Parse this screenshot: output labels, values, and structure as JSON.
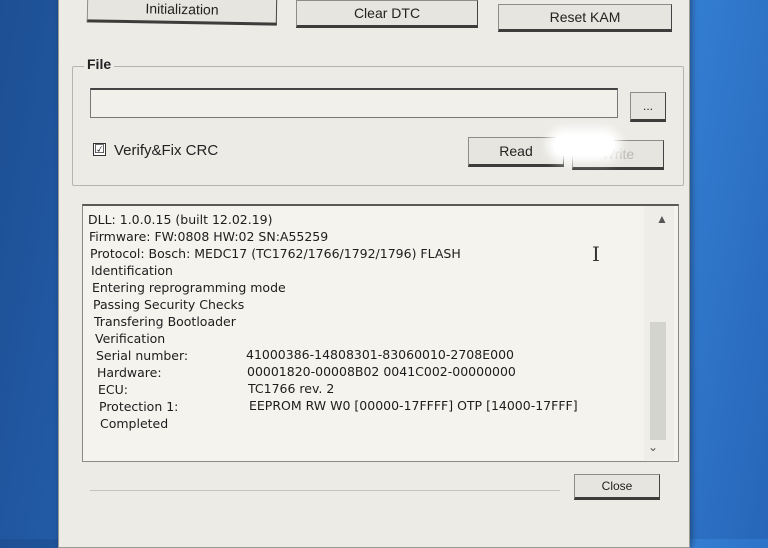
{
  "toolbar": {
    "initialization": "Initialization",
    "clear_dtc": "Clear DTC",
    "reset_kam": "Reset KAM"
  },
  "file_group": {
    "title": "File",
    "path_value": "",
    "browse": "...",
    "verify_label": "Verify&Fix CRC",
    "verify_checked": "☑",
    "read": "Read",
    "write": "Write"
  },
  "log": {
    "lines": [
      "DLL: 1.0.0.15 (built 12.02.19)",
      "Firmware: FW:0808 HW:02 SN:A55259",
      "Protocol: Bosch: MEDC17 (TC1762/1766/1792/1796) FLASH",
      "Identification",
      "Entering reprogramming mode",
      "Passing Security Checks",
      "Transfering Bootloader",
      "Verification",
      "Serial number:",
      "Hardware:",
      "ECU:",
      "Protection 1:",
      "Completed"
    ],
    "values": {
      "serial": "41000386-14808301-83060010-2708E000",
      "hardware": "00001820-00008B02 0041C002-00000000",
      "ecu": "TC1766 rev. 2",
      "protection": "EEPROM RW W0 [00000-17FFFF] OTP [14000-17FFF]"
    }
  },
  "footer": {
    "close": "Close"
  },
  "colors": {
    "desktop": "#2a6ec3",
    "dialog": "#ecebe6",
    "log_bg": "#f4f3ee"
  }
}
